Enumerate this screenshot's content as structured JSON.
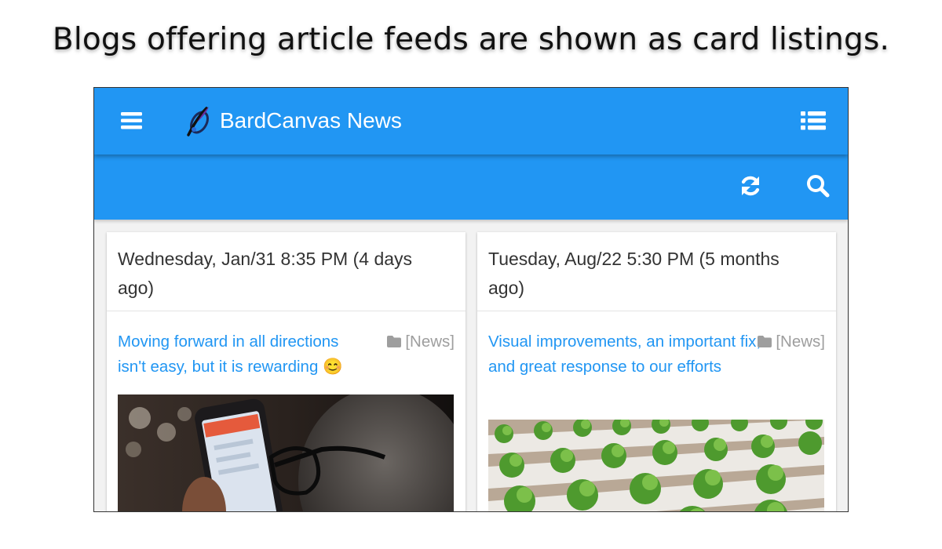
{
  "caption": "Blogs offering article feeds are shown as card listings.",
  "header": {
    "site_title": "BardCanvas News",
    "menu_icon": "hamburger-menu-icon",
    "list_icon": "list-icon",
    "brand_color": "#2196f3"
  },
  "toolbar": {
    "refresh_icon": "refresh-icon",
    "search_icon": "search-icon"
  },
  "posts": [
    {
      "date": "Wednesday, Jan/31 8:35 PM (4 days ago)",
      "title": "Moving forward in all directions isn't easy, but it is rewarding 😊",
      "category": "[News]",
      "image": "person-with-glasses-looking-at-phone-photo"
    },
    {
      "date": "Tuesday, Aug/22 5:30 PM (5 months ago)",
      "title": "Visual improvements, an important fix, and great response to our efforts",
      "category": "[News]",
      "image": "lettuce-hydroponic-farm-photo"
    }
  ]
}
